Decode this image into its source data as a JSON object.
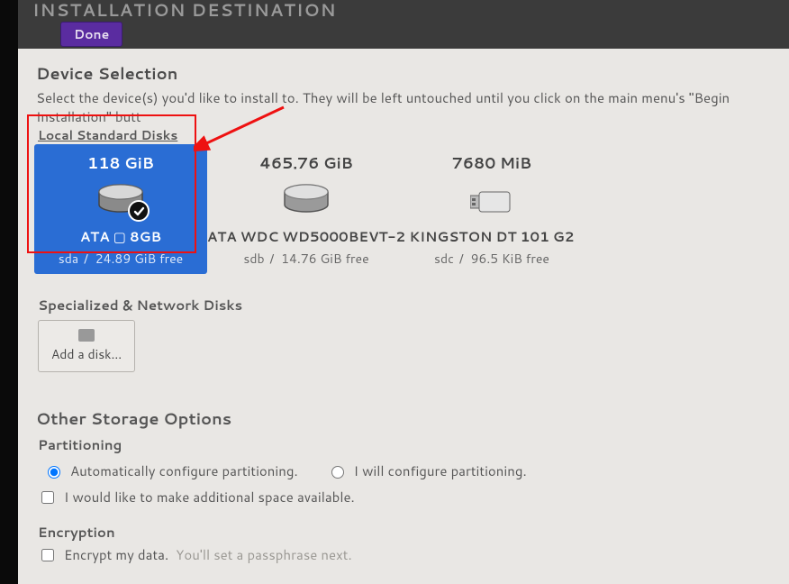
{
  "titlebar": {
    "title": "INSTALLATION DESTINATION",
    "done": "Done"
  },
  "device_selection": {
    "heading": "Device Selection",
    "description": "Select the device(s) you'd like to install to.  They will be left untouched until you click on the main menu's \"Begin Installation\" butt"
  },
  "local_disks": {
    "legend": "Local Standard Disks",
    "items": [
      {
        "size": "118 GiB",
        "name": "ATA ▢ 8GB",
        "dev": "sda",
        "free": "24.89 GiB free",
        "selected": true
      },
      {
        "size": "465.76 GiB",
        "name": "ATA WDC WD5000BEVT-2",
        "dev": "sdb",
        "free": "14.76 GiB free",
        "selected": false
      },
      {
        "size": "7680 MiB",
        "name": "KINGSTON DT 101 G2",
        "dev": "sdc",
        "free": "96.5 KiB free",
        "selected": false
      }
    ]
  },
  "network_disks": {
    "legend": "Specialized & Network Disks",
    "add_disk_label": "Add a disk..."
  },
  "other": {
    "heading": "Other Storage Options",
    "partitioning": {
      "legend": "Partitioning",
      "auto": "Automatically configure partitioning.",
      "manual": "I will configure partitioning.",
      "reclaim": "I would like to make additional space available."
    },
    "encryption": {
      "legend": "Encryption",
      "encrypt": "Encrypt my data.",
      "hint": "You'll set a passphrase next."
    }
  },
  "sep": " / "
}
